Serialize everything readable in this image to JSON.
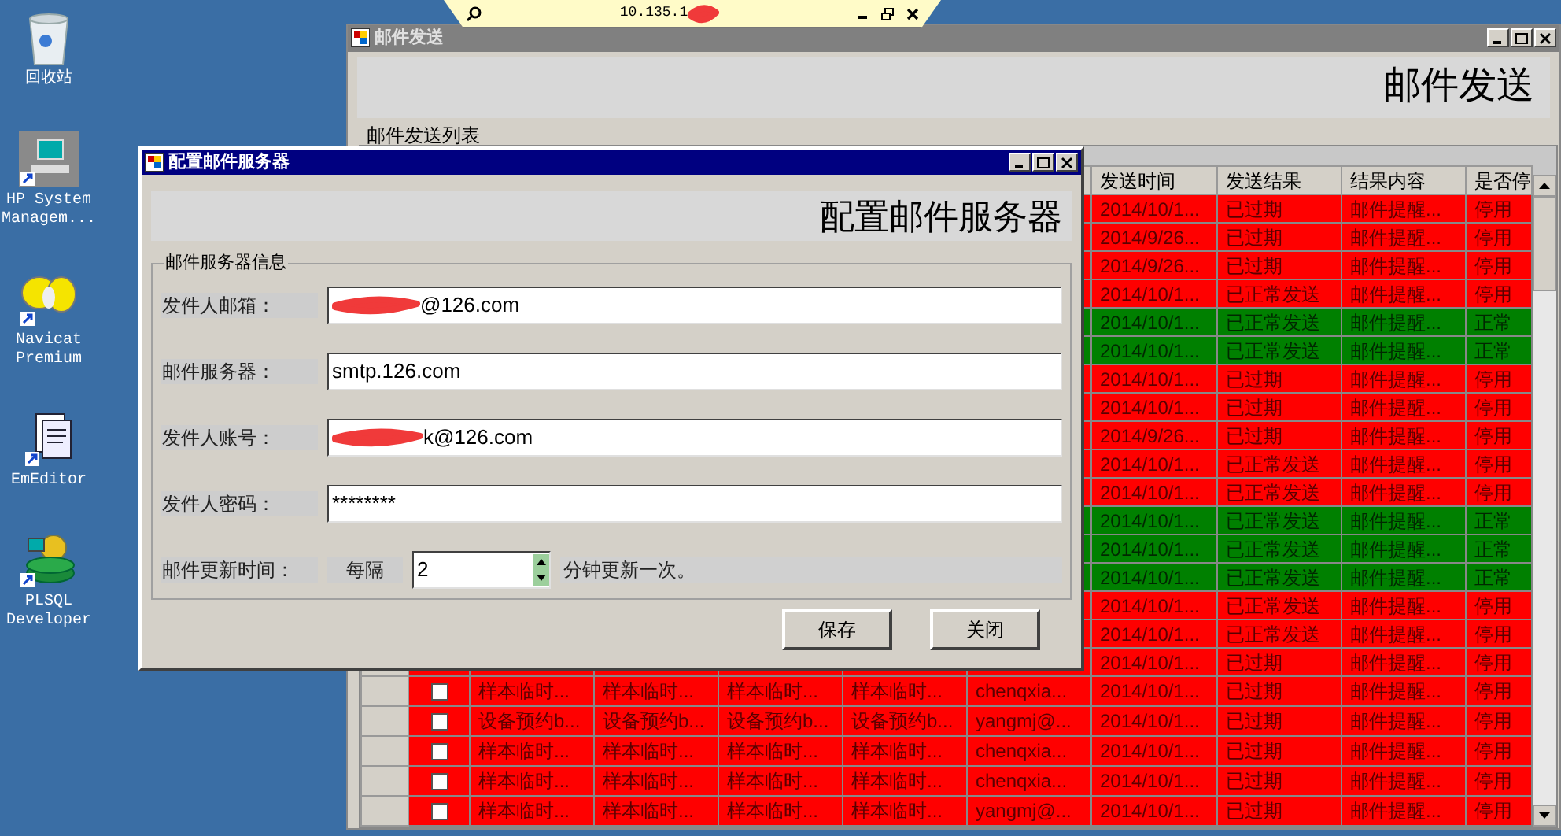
{
  "remote_bar": {
    "address": "10.135.1"
  },
  "desktop_icons": [
    {
      "kind": "bin",
      "label": "回收站"
    },
    {
      "kind": "computer",
      "label": "HP System Managem..."
    },
    {
      "kind": "butterfly",
      "label": "Navicat Premium"
    },
    {
      "kind": "document",
      "label": "EmEditor"
    },
    {
      "kind": "database",
      "label": "PLSQL Developer"
    }
  ],
  "main_window": {
    "title": "邮件发送",
    "heading": "邮件发送",
    "list_label": "邮件发送列表",
    "table": {
      "columns": [
        "发送时间",
        "发送结果",
        "结果内容",
        "是否停"
      ],
      "rows": [
        {
          "time": "2014/10/1...",
          "result": "已过期",
          "content": "邮件提醒...",
          "status": "停用",
          "color": "#ff0000"
        },
        {
          "time": "2014/9/26...",
          "result": "已过期",
          "content": "邮件提醒...",
          "status": "停用",
          "color": "#ff0000"
        },
        {
          "time": "2014/9/26...",
          "result": "已过期",
          "content": "邮件提醒...",
          "status": "停用",
          "color": "#ff0000"
        },
        {
          "time": "2014/10/1...",
          "result": "已正常发送",
          "content": "邮件提醒...",
          "status": "停用",
          "color": "#ff0000"
        },
        {
          "time": "2014/10/1...",
          "result": "已正常发送",
          "content": "邮件提醒...",
          "status": "正常",
          "color": "#008000"
        },
        {
          "time": "2014/10/1...",
          "result": "已正常发送",
          "content": "邮件提醒...",
          "status": "正常",
          "color": "#008000"
        },
        {
          "time": "2014/10/1...",
          "result": "已过期",
          "content": "邮件提醒...",
          "status": "停用",
          "color": "#ff0000"
        },
        {
          "time": "2014/10/1...",
          "result": "已过期",
          "content": "邮件提醒...",
          "status": "停用",
          "color": "#ff0000"
        },
        {
          "time": "2014/9/26...",
          "result": "已过期",
          "content": "邮件提醒...",
          "status": "停用",
          "color": "#ff0000"
        },
        {
          "time": "2014/10/1...",
          "result": "已正常发送",
          "content": "邮件提醒...",
          "status": "停用",
          "color": "#ff0000"
        },
        {
          "time": "2014/10/1...",
          "result": "已正常发送",
          "content": "邮件提醒...",
          "status": "停用",
          "color": "#ff0000"
        },
        {
          "time": "2014/10/1...",
          "result": "已正常发送",
          "content": "邮件提醒...",
          "status": "正常",
          "color": "#008000"
        },
        {
          "time": "2014/10/1...",
          "result": "已正常发送",
          "content": "邮件提醒...",
          "status": "正常",
          "color": "#008000"
        },
        {
          "time": "2014/10/1...",
          "result": "已正常发送",
          "content": "邮件提醒...",
          "status": "正常",
          "color": "#008000"
        },
        {
          "time": "2014/10/1...",
          "result": "已正常发送",
          "content": "邮件提醒...",
          "status": "停用",
          "color": "#ff0000"
        },
        {
          "time": "2014/10/1...",
          "result": "已正常发送",
          "content": "邮件提醒...",
          "status": "停用",
          "color": "#ff0000"
        },
        {
          "time": "2014/10/1...",
          "result": "已过期",
          "content": "邮件提醒...",
          "status": "停用",
          "color": "#ff0000"
        },
        {
          "checked": false,
          "cells": [
            "样本临时...",
            "样本临时...",
            "样本临时...",
            "样本临时...",
            "chenqxia..."
          ],
          "time": "2014/10/1...",
          "result": "已过期",
          "content": "邮件提醒...",
          "status": "停用",
          "color": "#ff0000"
        },
        {
          "checked": false,
          "cells": [
            "设备预约b...",
            "设备预约b...",
            "设备预约b...",
            "设备预约b...",
            "yangmj@..."
          ],
          "time": "2014/10/1...",
          "result": "已过期",
          "content": "邮件提醒...",
          "status": "停用",
          "color": "#ff0000"
        },
        {
          "checked": false,
          "cells": [
            "样本临时...",
            "样本临时...",
            "样本临时...",
            "样本临时...",
            "chenqxia..."
          ],
          "time": "2014/10/1...",
          "result": "已过期",
          "content": "邮件提醒...",
          "status": "停用",
          "color": "#ff0000"
        },
        {
          "checked": false,
          "cells": [
            "样本临时...",
            "样本临时...",
            "样本临时...",
            "样本临时...",
            "chenqxia..."
          ],
          "time": "2014/10/1...",
          "result": "已过期",
          "content": "邮件提醒...",
          "status": "停用",
          "color": "#ff0000"
        },
        {
          "checked": false,
          "cells": [
            "样本临时...",
            "样本临时...",
            "样本临时...",
            "样本临时...",
            "yangmj@..."
          ],
          "time": "2014/10/1...",
          "result": "已过期",
          "content": "邮件提醒...",
          "status": "停用",
          "color": "#ff0000"
        }
      ]
    }
  },
  "dialog": {
    "title": "配置邮件服务器",
    "heading": "配置邮件服务器",
    "group_label": "邮件服务器信息",
    "fields": [
      {
        "label": "发件人邮箱：",
        "value": "@126.com",
        "redacted": true
      },
      {
        "label": "邮件服务器：",
        "value": "smtp.126.com",
        "redacted": false
      },
      {
        "label": "发件人账号：",
        "value": "k@126.com",
        "redacted": true
      },
      {
        "label": "发件人密码：",
        "value": "********",
        "redacted": false
      }
    ],
    "interval": {
      "label": "邮件更新时间：",
      "prefix": "每隔",
      "value": "2",
      "suffix": "分钟更新一次。"
    },
    "buttons": [
      "保存",
      "关闭"
    ]
  }
}
